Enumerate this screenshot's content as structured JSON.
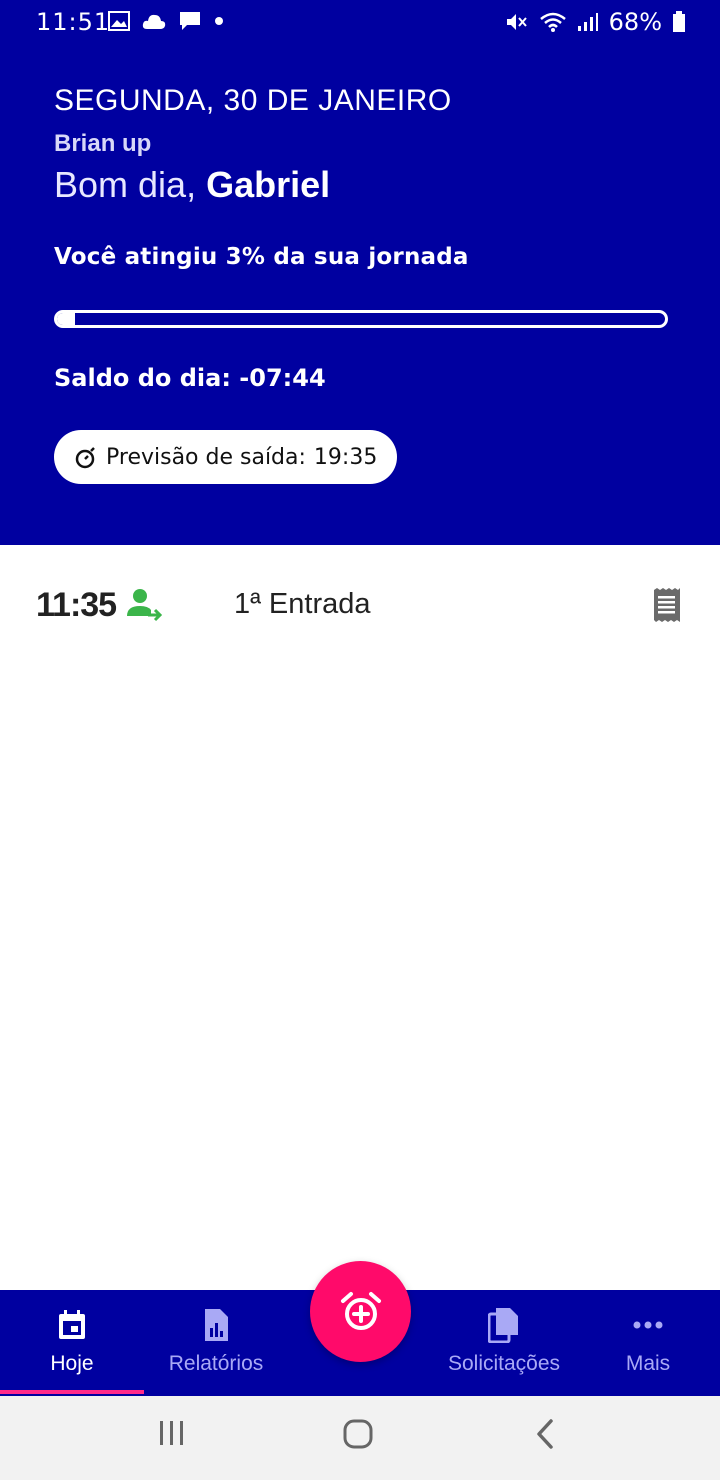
{
  "status_bar": {
    "time": "11:51",
    "battery": "68%"
  },
  "header": {
    "date": "SEGUNDA, 30 DE JANEIRO",
    "company": "Brian up",
    "greeting_prefix": "Bom dia,",
    "user_name": "Gabriel",
    "journey_text": "Você atingiu 3% da sua jornada",
    "journey_percent": 3,
    "balance_text": "Saldo do dia: -07:44",
    "exit_label": "Previsão de saída:",
    "exit_time": "19:35"
  },
  "entries": [
    {
      "time": "11:35",
      "label": "1ª Entrada"
    }
  ],
  "bottom_nav": {
    "items": [
      {
        "label": "Hoje",
        "icon": "calendar-icon",
        "active": true
      },
      {
        "label": "Relatórios",
        "icon": "report-icon",
        "active": false
      },
      {
        "label": "Solicitações",
        "icon": "documents-icon",
        "active": false
      },
      {
        "label": "Mais",
        "icon": "more-icon",
        "active": false
      }
    ],
    "fab_icon": "alarm-add-icon"
  },
  "colors": {
    "primary": "#0000a0",
    "accent": "#ff0a6a",
    "entry_icon": "#3bb54a"
  }
}
